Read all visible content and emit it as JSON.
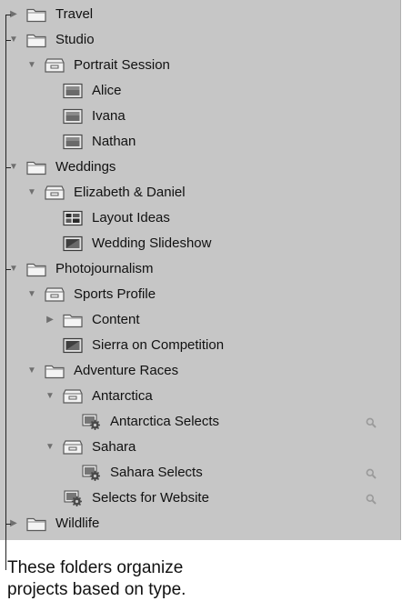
{
  "library": {
    "items": [
      {
        "label": "Travel",
        "depth": 0,
        "icon": "folder",
        "disclosure": "collapsed",
        "search": false
      },
      {
        "label": "Studio",
        "depth": 0,
        "icon": "folder",
        "disclosure": "expanded",
        "search": false
      },
      {
        "label": "Portrait Session",
        "depth": 1,
        "icon": "project",
        "disclosure": "expanded",
        "search": false
      },
      {
        "label": "Alice",
        "depth": 2,
        "icon": "album",
        "disclosure": "none",
        "search": false
      },
      {
        "label": "Ivana",
        "depth": 2,
        "icon": "album",
        "disclosure": "none",
        "search": false
      },
      {
        "label": "Nathan",
        "depth": 2,
        "icon": "album",
        "disclosure": "none",
        "search": false
      },
      {
        "label": "Weddings",
        "depth": 0,
        "icon": "folder",
        "disclosure": "expanded",
        "search": false
      },
      {
        "label": "Elizabeth & Daniel",
        "depth": 1,
        "icon": "project",
        "disclosure": "expanded",
        "search": false
      },
      {
        "label": "Layout Ideas",
        "depth": 2,
        "icon": "layout",
        "disclosure": "none",
        "search": false
      },
      {
        "label": "Wedding Slideshow",
        "depth": 2,
        "icon": "slideshow",
        "disclosure": "none",
        "search": false
      },
      {
        "label": "Photojournalism",
        "depth": 0,
        "icon": "folder",
        "disclosure": "expanded",
        "search": false
      },
      {
        "label": "Sports Profile",
        "depth": 1,
        "icon": "project",
        "disclosure": "expanded",
        "search": false
      },
      {
        "label": "Content",
        "depth": 2,
        "icon": "folder",
        "disclosure": "collapsed",
        "search": false
      },
      {
        "label": "Sierra on Competition",
        "depth": 2,
        "icon": "slideshow",
        "disclosure": "none",
        "search": false
      },
      {
        "label": "Adventure Races",
        "depth": 1,
        "icon": "folder",
        "disclosure": "expanded",
        "search": false
      },
      {
        "label": "Antarctica",
        "depth": 2,
        "icon": "project",
        "disclosure": "expanded",
        "search": false
      },
      {
        "label": "Antarctica Selects",
        "depth": 3,
        "icon": "smart-album",
        "disclosure": "none",
        "search": true
      },
      {
        "label": "Sahara",
        "depth": 2,
        "icon": "project",
        "disclosure": "expanded",
        "search": false
      },
      {
        "label": "Sahara Selects",
        "depth": 3,
        "icon": "smart-album",
        "disclosure": "none",
        "search": true
      },
      {
        "label": "Selects for Website",
        "depth": 2,
        "icon": "smart-album",
        "disclosure": "none",
        "search": true
      },
      {
        "label": "Wildlife",
        "depth": 0,
        "icon": "folder",
        "disclosure": "collapsed",
        "search": false
      }
    ]
  },
  "callout": {
    "line1": "These folders organize",
    "line2": "projects based on type."
  }
}
